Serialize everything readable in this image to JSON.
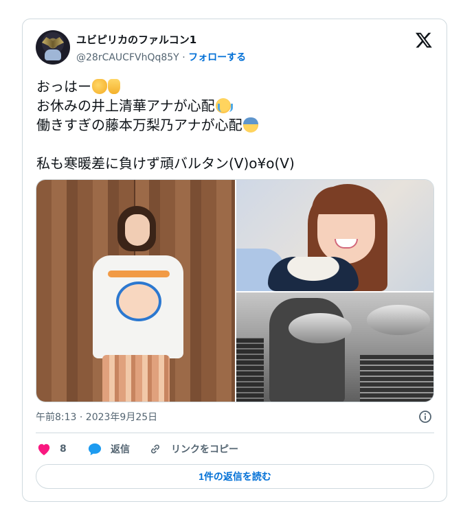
{
  "user": {
    "name": "ユビピリカのファルコン1",
    "handle": "@28rCAUCFVhQq85Y",
    "separator": "·",
    "follow_label": "フォローする"
  },
  "tweet": {
    "lines": [
      "おっはー",
      "お休みの井上清華アナが心配",
      "働きすぎの藤本万梨乃アナが心配",
      "",
      "私も寒暖差に負けず頑バルタン(V)o¥o(V)"
    ],
    "emojis": [
      "ok-hand",
      "raised-hand",
      "loudly-crying-face",
      "downcast-face-with-sweat"
    ]
  },
  "media": {
    "photos": [
      "photo-woman-tshirt",
      "photo-woman-bowl",
      "photo-baltan-monster"
    ]
  },
  "timestamp": "午前8:13 · 2023年9月25日",
  "actions": {
    "like_count": "8",
    "reply_label": "返信",
    "copy_link_label": "リンクをコピー"
  },
  "read_replies_label": "1件の返信を読む",
  "colors": {
    "accent": "#006fd6",
    "like": "#f91880",
    "reply": "#1d9bf0",
    "text": "#0f1419",
    "muted": "#536471",
    "border": "#cfd9de"
  }
}
